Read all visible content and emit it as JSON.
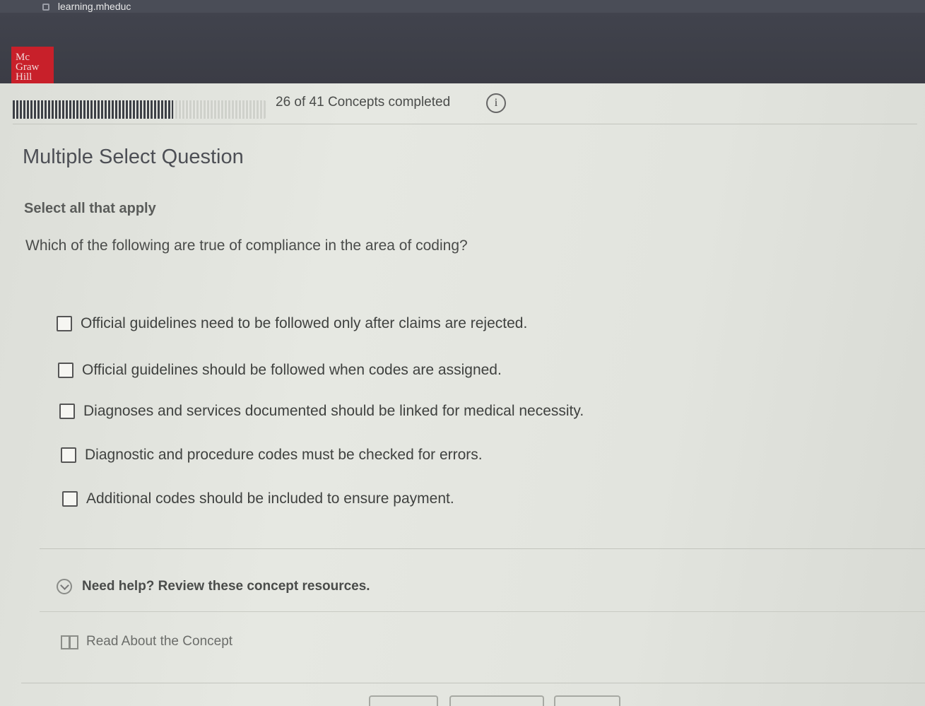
{
  "browser": {
    "url_fragment": "learning.mheduc"
  },
  "logo": {
    "lines": [
      "Mc",
      "Graw",
      "Hill"
    ]
  },
  "progress": {
    "completed": 26,
    "total": 41,
    "fraction": 0.634,
    "label": "26 of 41 Concepts completed"
  },
  "question": {
    "type_title": "Multiple Select Question",
    "instruction": "Select all that apply",
    "prompt": "Which of the following are true of compliance in the area of coding?",
    "options": [
      {
        "label": "Official guidelines need to be followed only after claims are rejected.",
        "checked": false
      },
      {
        "label": "Official guidelines should be followed when codes are assigned.",
        "checked": false
      },
      {
        "label": "Diagnoses and services documented should be linked for medical necessity.",
        "checked": false
      },
      {
        "label": "Diagnostic and procedure codes must be checked for errors.",
        "checked": false
      },
      {
        "label": "Additional codes should be included to ensure payment.",
        "checked": false
      }
    ]
  },
  "help": {
    "toggle_label": "Need help? Review these concept resources.",
    "resource_label": "Read About the Concept"
  },
  "colors": {
    "logo_red": "#c8202a",
    "header_dark": "#3d3f48"
  }
}
